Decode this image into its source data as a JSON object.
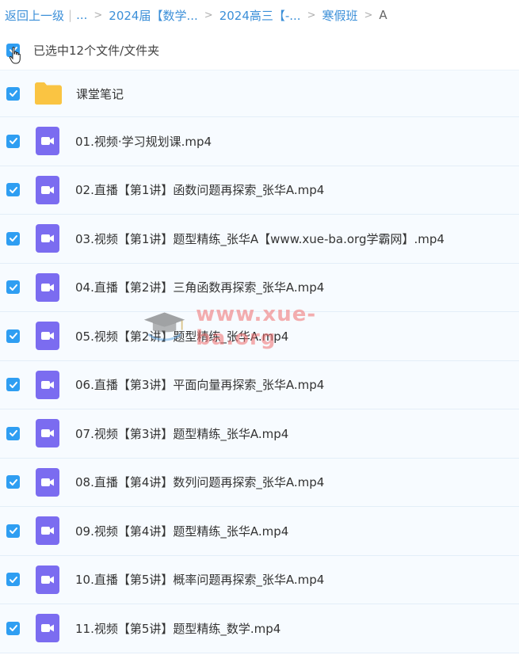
{
  "breadcrumb": {
    "back": "返回上一级",
    "ellipsis": "...",
    "crumb1": "2024届【数学...",
    "crumb2": "2024高三【-...",
    "crumb3": "寒假班",
    "current": "A"
  },
  "selection": {
    "label": "已选中12个文件/文件夹"
  },
  "colors": {
    "accent": "#2f9ef2",
    "video_icon": "#7b6cf0",
    "folder": "#f9c443"
  },
  "items": [
    {
      "name": "课堂笔记",
      "type": "folder",
      "icon": "folder-icon"
    },
    {
      "name": "01.视频·学习规划课.mp4",
      "type": "video",
      "icon": "video-file-icon"
    },
    {
      "name": "02.直播【第1讲】函数问题再探索_张华A.mp4",
      "type": "video",
      "icon": "video-file-icon"
    },
    {
      "name": "03.视频【第1讲】题型精练_张华A【www.xue-ba.org学霸网】.mp4",
      "type": "video",
      "icon": "video-file-icon"
    },
    {
      "name": "04.直播【第2讲】三角函数再探索_张华A.mp4",
      "type": "video",
      "icon": "video-file-icon"
    },
    {
      "name": "05.视频【第2讲】题型精练_张华A.mp4",
      "type": "video",
      "icon": "video-file-icon"
    },
    {
      "name": "06.直播【第3讲】平面向量再探索_张华A.mp4",
      "type": "video",
      "icon": "video-file-icon"
    },
    {
      "name": "07.视频【第3讲】题型精练_张华A.mp4",
      "type": "video",
      "icon": "video-file-icon"
    },
    {
      "name": "08.直播【第4讲】数列问题再探索_张华A.mp4",
      "type": "video",
      "icon": "video-file-icon"
    },
    {
      "name": "09.视频【第4讲】题型精练_张华A.mp4",
      "type": "video",
      "icon": "video-file-icon"
    },
    {
      "name": "10.直播【第5讲】概率问题再探索_张华A.mp4",
      "type": "video",
      "icon": "video-file-icon"
    },
    {
      "name": "11.视频【第5讲】题型精练_数学.mp4",
      "type": "video",
      "icon": "video-file-icon"
    }
  ],
  "watermark": {
    "text": "www.xue-ba.org"
  }
}
